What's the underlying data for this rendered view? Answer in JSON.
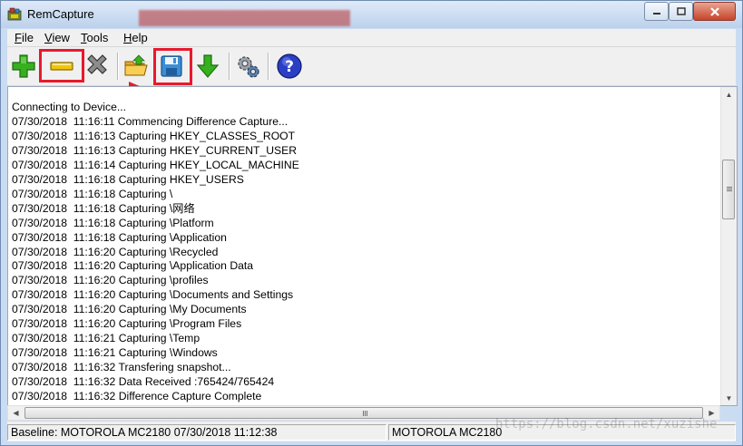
{
  "window": {
    "title": "RemCapture"
  },
  "menu": [
    {
      "pre": "",
      "acc": "F",
      "post": "ile"
    },
    {
      "pre": "",
      "acc": "V",
      "post": "iew"
    },
    {
      "pre": "",
      "acc": "T",
      "post": "ools"
    },
    {
      "pre": "",
      "acc": "H",
      "post": "elp"
    }
  ],
  "toolbar_icons": [
    "add-icon",
    "remove-icon",
    "delete-icon",
    "open-folder-icon",
    "save-icon",
    "download-icon",
    "settings-gears-icon",
    "help-icon"
  ],
  "log": [
    "Connecting to Device...",
    "07/30/2018  11:16:11 Commencing Difference Capture...",
    "07/30/2018  11:16:13 Capturing HKEY_CLASSES_ROOT",
    "07/30/2018  11:16:13 Capturing HKEY_CURRENT_USER",
    "07/30/2018  11:16:14 Capturing HKEY_LOCAL_MACHINE",
    "07/30/2018  11:16:18 Capturing HKEY_USERS",
    "07/30/2018  11:16:18 Capturing \\",
    "07/30/2018  11:16:18 Capturing \\网络",
    "07/30/2018  11:16:18 Capturing \\Platform",
    "07/30/2018  11:16:18 Capturing \\Application",
    "07/30/2018  11:16:20 Capturing \\Recycled",
    "07/30/2018  11:16:20 Capturing \\Application Data",
    "07/30/2018  11:16:20 Capturing \\profiles",
    "07/30/2018  11:16:20 Capturing \\Documents and Settings",
    "07/30/2018  11:16:20 Capturing \\My Documents",
    "07/30/2018  11:16:20 Capturing \\Program Files",
    "07/30/2018  11:16:21 Capturing \\Temp",
    "07/30/2018  11:16:21 Capturing \\Windows",
    "07/30/2018  11:16:32 Transfering snapshot...",
    "07/30/2018  11:16:32 Data Received :765424/765424",
    "07/30/2018  11:16:32 Difference Capture Complete"
  ],
  "status": {
    "baseline": "Baseline: MOTOROLA MC2180  07/30/2018  11:12:38",
    "device": "MOTOROLA MC2180"
  },
  "watermark": "https://blog.csdn.net/xuzishe",
  "colors": {
    "highlight": "#e8192c",
    "help_blue": "#2a3fc4",
    "add_green": "#2fa61b"
  }
}
